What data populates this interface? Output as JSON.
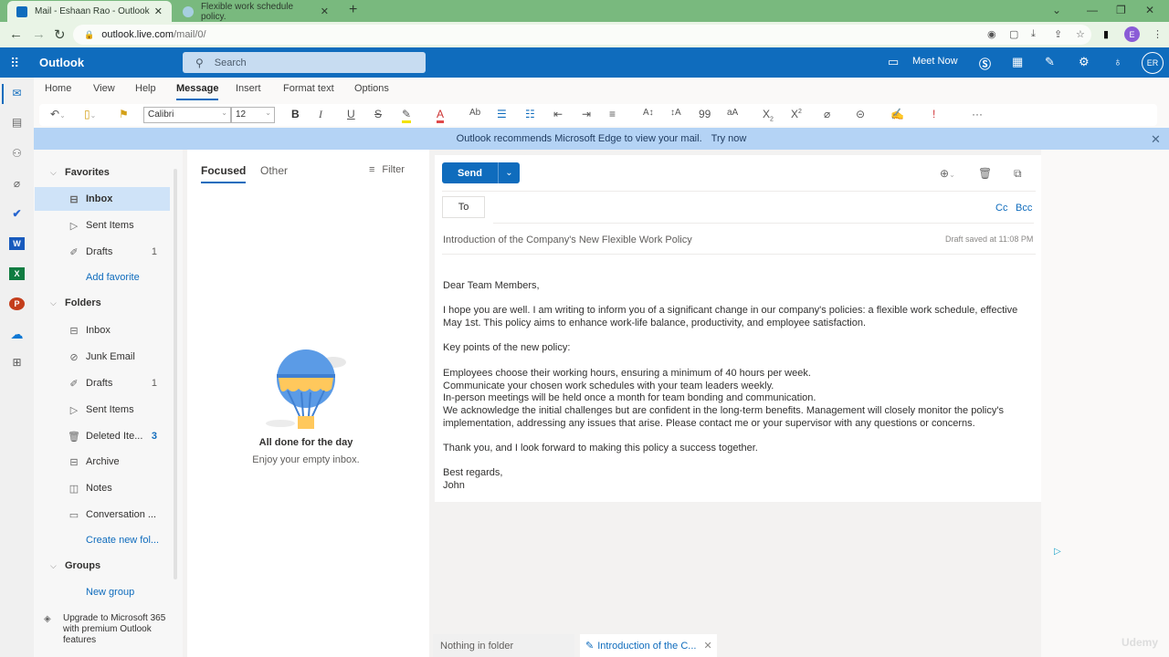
{
  "browser": {
    "tabs": [
      {
        "title": "Mail - Eshaan Rao - Outlook",
        "active": true
      },
      {
        "title": "Flexible work schedule policy.",
        "active": false
      }
    ],
    "new_tab": "+",
    "url_host": "outlook.live.com",
    "url_path": "/mail/0/",
    "profile_initial": "E"
  },
  "app": {
    "name": "Outlook",
    "search_placeholder": "Search",
    "meet_now": "Meet Now",
    "user_initials": "ER",
    "accent_color": "#0f6cbd"
  },
  "ribbon": {
    "tabs": [
      "Home",
      "View",
      "Help",
      "Message",
      "Insert",
      "Format text",
      "Options"
    ],
    "selected_tab": "Message",
    "font": "Calibri",
    "font_size": "12"
  },
  "banner": {
    "text": "Outlook recommends Microsoft Edge to view your mail.",
    "link": "Try now"
  },
  "folders": {
    "favorites_label": "Favorites",
    "favorites": [
      {
        "label": "Inbox",
        "count": "",
        "selected": true
      },
      {
        "label": "Sent Items",
        "count": ""
      },
      {
        "label": "Drafts",
        "count": "1"
      }
    ],
    "add_favorite": "Add favorite",
    "folders_label": "Folders",
    "folders": [
      {
        "label": "Inbox",
        "count": ""
      },
      {
        "label": "Junk Email",
        "count": ""
      },
      {
        "label": "Drafts",
        "count": "1"
      },
      {
        "label": "Sent Items",
        "count": ""
      },
      {
        "label": "Deleted Ite...",
        "count": "3"
      },
      {
        "label": "Archive",
        "count": ""
      },
      {
        "label": "Notes",
        "count": ""
      },
      {
        "label": "Conversation ...",
        "count": ""
      }
    ],
    "create_folder": "Create new fol...",
    "groups_label": "Groups",
    "new_group": "New group",
    "upgrade": "Upgrade to Microsoft 365 with premium Outlook features"
  },
  "message_list": {
    "tab_focused": "Focused",
    "tab_other": "Other",
    "filter": "Filter",
    "empty_title": "All done for the day",
    "empty_subtitle": "Enjoy your empty inbox."
  },
  "compose": {
    "send": "Send",
    "to_label": "To",
    "cc": "Cc",
    "bcc": "Bcc",
    "subject": "Introduction of the Company's New Flexible Work Policy",
    "draft_saved": "Draft saved at 11:08 PM",
    "body": {
      "greeting": "Dear Team Members,",
      "para1": "I hope you are well. I am writing to inform you of a significant change in our company's policies: a flexible work schedule, effective May 1st. This policy aims to enhance work-life balance, productivity, and employee satisfaction.",
      "key_points_intro": "Key points of the new policy:",
      "points": [
        "Employees choose their working hours, ensuring a minimum of 40 hours per week.",
        "Communicate your chosen work schedules with your team leaders weekly.",
        "In-person meetings will be held once a month for team bonding and communication.",
        "We acknowledge the initial challenges but are confident in the long-term benefits. Management will closely monitor the policy's implementation, addressing any issues that arise. Please contact me or your supervisor with any questions or concerns."
      ],
      "thanks": "Thank you, and I look forward to making this policy a success together.",
      "closing": "Best regards,",
      "signature": "John"
    }
  },
  "bottom_tabs": {
    "nothing": "Nothing in folder",
    "draft_tab": "Introduction of the C..."
  },
  "watermark": "Udemy"
}
